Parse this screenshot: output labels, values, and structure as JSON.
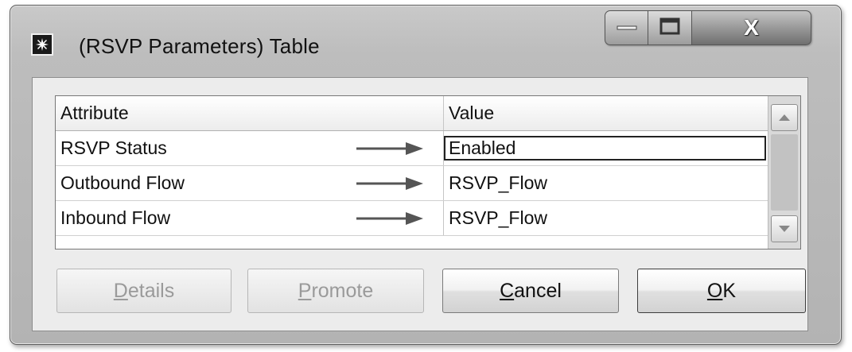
{
  "window": {
    "title": "(RSVP Parameters) Table",
    "icon": "app-star-icon"
  },
  "caption_buttons": {
    "minimize_icon": "minimize-icon",
    "maximize_icon": "maximize-icon",
    "close_label": "X"
  },
  "table": {
    "columns": [
      "Attribute",
      "Value"
    ],
    "rows": [
      {
        "attribute": "RSVP Status",
        "value": "Enabled",
        "focused": true
      },
      {
        "attribute": "Outbound Flow",
        "value": "RSVP_Flow"
      },
      {
        "attribute": "Inbound Flow",
        "value": "RSVP_Flow"
      }
    ],
    "row_arrow_icon": "right-arrow-icon"
  },
  "buttons": {
    "details": {
      "mnemonic": "D",
      "rest": "etails",
      "enabled": false
    },
    "promote": {
      "mnemonic": "P",
      "rest": "romote",
      "enabled": false
    },
    "cancel": {
      "mnemonic": "C",
      "rest": "ancel",
      "enabled": true
    },
    "ok": {
      "mnemonic": "O",
      "rest": "K",
      "enabled": true
    }
  },
  "colors": {
    "window_frame": "#bdbdbd",
    "client_bg": "#ececec",
    "disabled_text": "#9a9a9a"
  }
}
